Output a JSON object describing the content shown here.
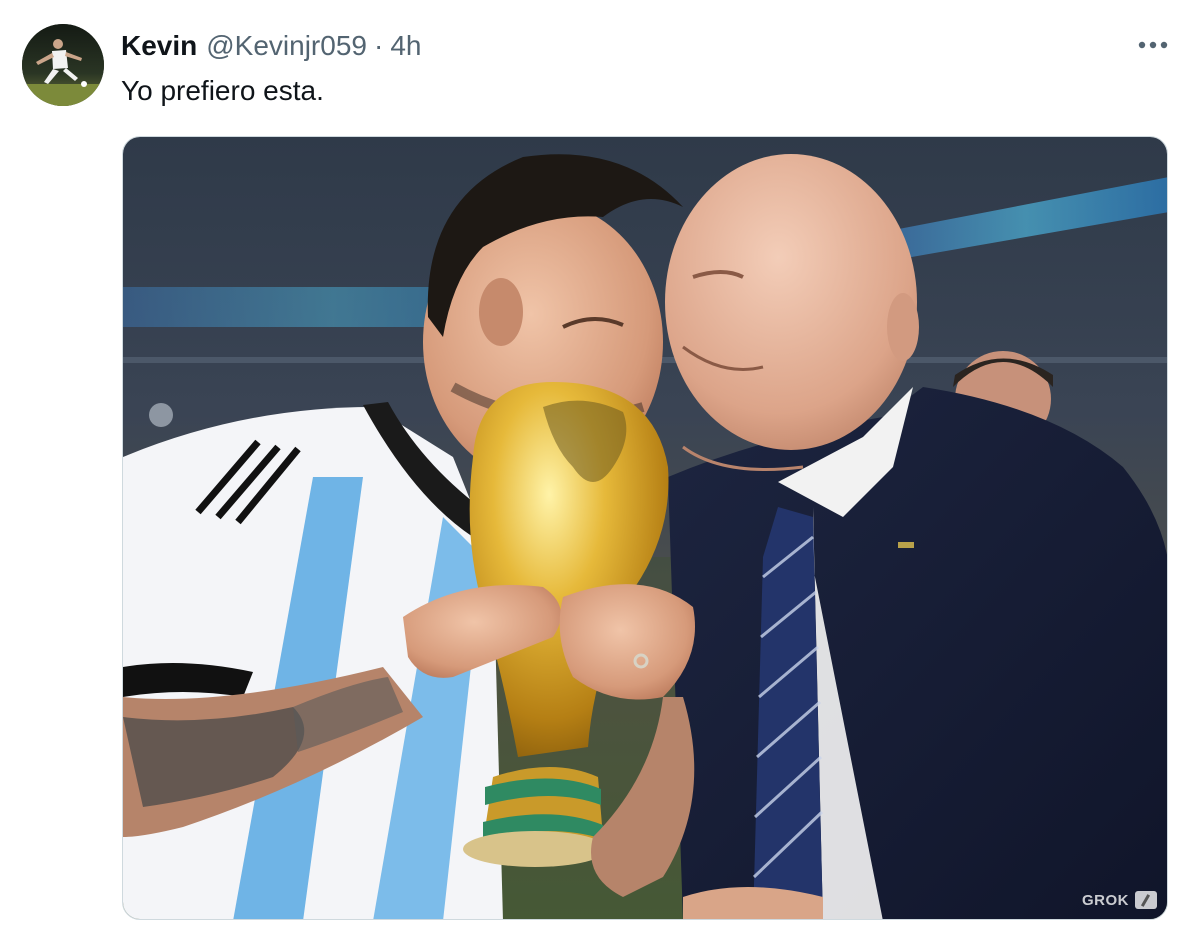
{
  "tweet": {
    "display_name": "Kevin",
    "handle": "@Kevinjr059",
    "separator": "·",
    "time": "4h",
    "text": "Yo prefiero esta.",
    "more_icon": "ellipsis-icon"
  },
  "media": {
    "watermark": "GROK"
  },
  "colors": {
    "text_primary": "#0f1419",
    "text_secondary": "#536471",
    "border": "#cfd9de"
  }
}
